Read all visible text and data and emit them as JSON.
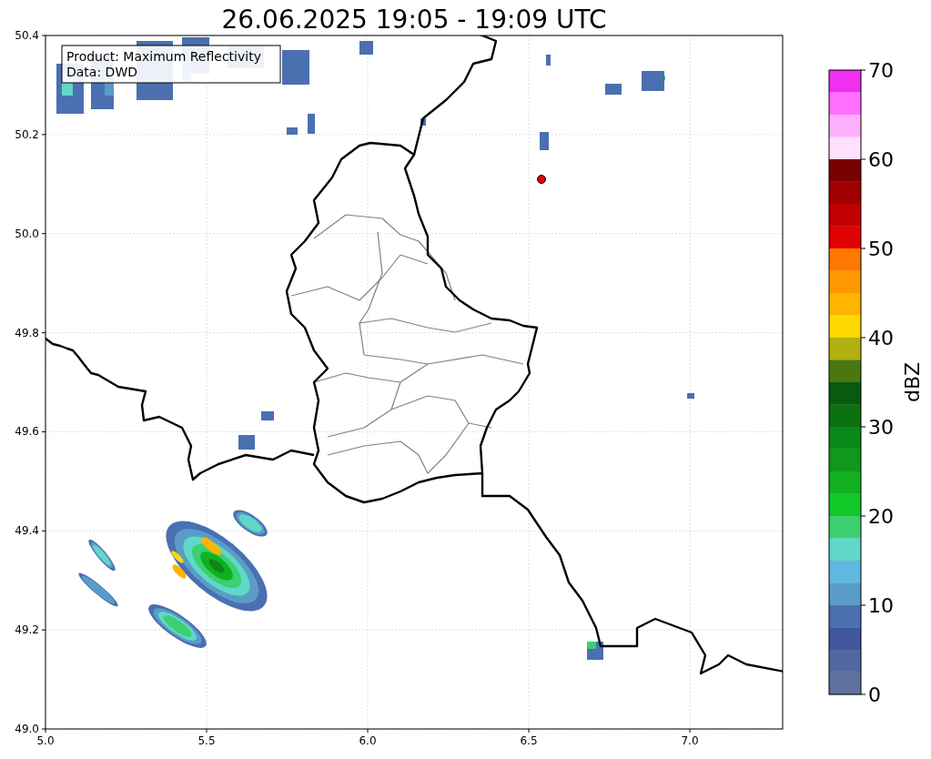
{
  "title": "26.06.2025 19:05 - 19:09 UTC",
  "map": {
    "annotation": [
      "Product: Maximum Reflectivity",
      "Data: DWD"
    ],
    "x_ticks": [
      "5.0",
      "5.5",
      "6.0",
      "6.5",
      "7.0"
    ],
    "y_ticks": [
      "50.4",
      "50.2",
      "50.0",
      "49.8",
      "49.6",
      "49.4",
      "49.2",
      "49.0"
    ]
  },
  "colorbar": {
    "label": "dBZ",
    "ticks": [
      "70",
      "60",
      "50",
      "40",
      "30",
      "20",
      "10",
      "0"
    ],
    "bands": [
      {
        "color": "#f030f0"
      },
      {
        "color": "#ff70ff"
      },
      {
        "color": "#ffb0ff"
      },
      {
        "color": "#ffe0ff"
      },
      {
        "color": "#780000"
      },
      {
        "color": "#a00000"
      },
      {
        "color": "#c00000"
      },
      {
        "color": "#e00000"
      },
      {
        "color": "#ff7800"
      },
      {
        "color": "#ff9800"
      },
      {
        "color": "#ffb400"
      },
      {
        "color": "#ffd800"
      },
      {
        "color": "#b0b010"
      },
      {
        "color": "#4a7810"
      },
      {
        "color": "#085a10"
      },
      {
        "color": "#0a7010"
      },
      {
        "color": "#0a8818"
      },
      {
        "color": "#109818"
      },
      {
        "color": "#10b020"
      },
      {
        "color": "#10c828"
      },
      {
        "color": "#3cd070"
      },
      {
        "color": "#60d8c8"
      },
      {
        "color": "#60b8e0"
      },
      {
        "color": "#5a9cc8"
      },
      {
        "color": "#4a70b0"
      },
      {
        "color": "#4058a0"
      },
      {
        "color": "#5468a0"
      },
      {
        "color": "#6070a0"
      }
    ]
  }
}
